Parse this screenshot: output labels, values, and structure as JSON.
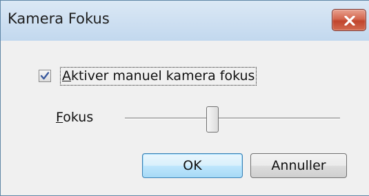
{
  "window": {
    "title": "Kamera Fokus",
    "close_icon": "close-x-icon"
  },
  "manual_focus": {
    "checked": true,
    "label_mnemonic": "A",
    "label_rest": "ktiver manuel kamera fokus"
  },
  "focus": {
    "label_mnemonic": "F",
    "label_rest": "okus",
    "slider_value_fraction": 0.4
  },
  "buttons": {
    "ok_label": "OK",
    "cancel_label": "Annuller"
  },
  "colors": {
    "titlebar": "#c2d8ee",
    "close_button": "#c0452d",
    "dialog_bg": "#f0f0f0",
    "default_button_border": "#3c7fb1",
    "check_mark": "#3a5a9e"
  }
}
